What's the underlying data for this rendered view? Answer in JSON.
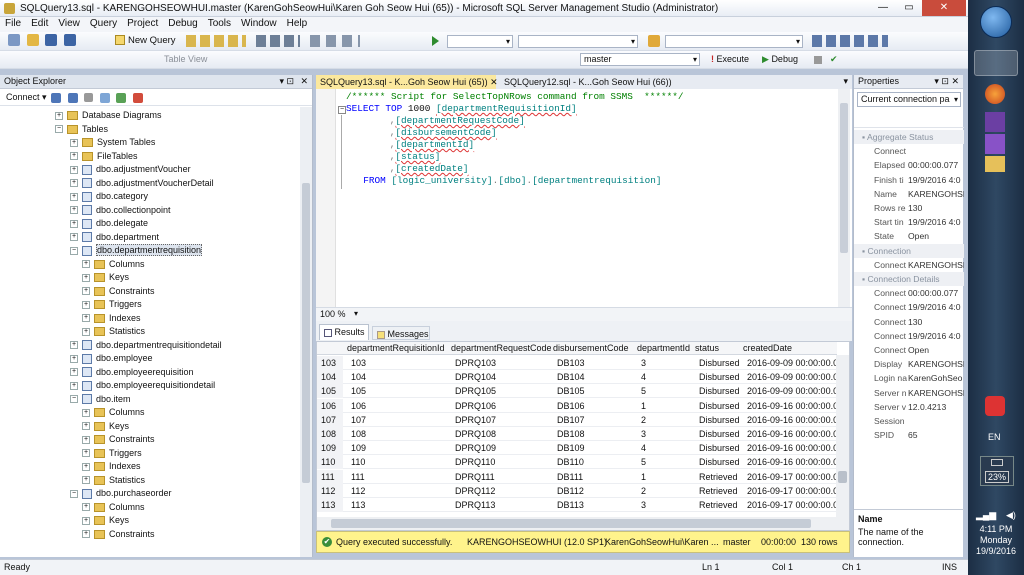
{
  "window": {
    "title": "SQLQuery13.sql - KARENGOHSEOWHUI.master (KarenGohSeowHui\\Karen Goh Seow Hui (65)) - Microsoft SQL Server Management Studio (Administrator)",
    "min": "—",
    "max": "▭",
    "close": "✕"
  },
  "menu": [
    "File",
    "Edit",
    "View",
    "Query",
    "Project",
    "Debug",
    "Tools",
    "Window",
    "Help"
  ],
  "toolbar": {
    "new_query": "New Query",
    "database": "master",
    "execute": "Execute",
    "debug": "Debug",
    "table_view": "Table View"
  },
  "object_explorer": {
    "title": "Object Explorer",
    "connect": "Connect",
    "nodes": [
      {
        "label": "Database Diagrams",
        "level": 1,
        "icon": "folder",
        "exp": "+"
      },
      {
        "label": "Tables",
        "level": 1,
        "icon": "folder",
        "exp": "−"
      },
      {
        "label": "System Tables",
        "level": 2,
        "icon": "folder",
        "exp": "+"
      },
      {
        "label": "FileTables",
        "level": 2,
        "icon": "folder",
        "exp": "+"
      },
      {
        "label": "dbo.adjustmentVoucher",
        "level": 2,
        "icon": "table",
        "exp": "+"
      },
      {
        "label": "dbo.adjustmentVoucherDetail",
        "level": 2,
        "icon": "table",
        "exp": "+"
      },
      {
        "label": "dbo.category",
        "level": 2,
        "icon": "table",
        "exp": "+"
      },
      {
        "label": "dbo.collectionpoint",
        "level": 2,
        "icon": "table",
        "exp": "+"
      },
      {
        "label": "dbo.delegate",
        "level": 2,
        "icon": "table",
        "exp": "+"
      },
      {
        "label": "dbo.department",
        "level": 2,
        "icon": "table",
        "exp": "+"
      },
      {
        "label": "dbo.departmentrequisition",
        "level": 2,
        "icon": "table",
        "exp": "−",
        "selected": true
      },
      {
        "label": "Columns",
        "level": 3,
        "icon": "folder",
        "exp": "+"
      },
      {
        "label": "Keys",
        "level": 3,
        "icon": "folder",
        "exp": "+"
      },
      {
        "label": "Constraints",
        "level": 3,
        "icon": "folder",
        "exp": "+"
      },
      {
        "label": "Triggers",
        "level": 3,
        "icon": "folder",
        "exp": "+"
      },
      {
        "label": "Indexes",
        "level": 3,
        "icon": "folder",
        "exp": "+"
      },
      {
        "label": "Statistics",
        "level": 3,
        "icon": "folder",
        "exp": "+"
      },
      {
        "label": "dbo.departmentrequisitiondetail",
        "level": 2,
        "icon": "table",
        "exp": "+"
      },
      {
        "label": "dbo.employee",
        "level": 2,
        "icon": "table",
        "exp": "+"
      },
      {
        "label": "dbo.employeerequisition",
        "level": 2,
        "icon": "table",
        "exp": "+"
      },
      {
        "label": "dbo.employeerequisitiondetail",
        "level": 2,
        "icon": "table",
        "exp": "+"
      },
      {
        "label": "dbo.item",
        "level": 2,
        "icon": "table",
        "exp": "−"
      },
      {
        "label": "Columns",
        "level": 3,
        "icon": "folder",
        "exp": "+"
      },
      {
        "label": "Keys",
        "level": 3,
        "icon": "folder",
        "exp": "+"
      },
      {
        "label": "Constraints",
        "level": 3,
        "icon": "folder",
        "exp": "+"
      },
      {
        "label": "Triggers",
        "level": 3,
        "icon": "folder",
        "exp": "+"
      },
      {
        "label": "Indexes",
        "level": 3,
        "icon": "folder",
        "exp": "+"
      },
      {
        "label": "Statistics",
        "level": 3,
        "icon": "folder",
        "exp": "+"
      },
      {
        "label": "dbo.purchaseorder",
        "level": 2,
        "icon": "table",
        "exp": "−"
      },
      {
        "label": "Columns",
        "level": 3,
        "icon": "folder",
        "exp": "+"
      },
      {
        "label": "Keys",
        "level": 3,
        "icon": "folder",
        "exp": "+"
      },
      {
        "label": "Constraints",
        "level": 3,
        "icon": "folder",
        "exp": "+"
      }
    ]
  },
  "tabs": [
    {
      "label": "SQLQuery13.sql - K...Goh Seow Hui (65))",
      "active": true
    },
    {
      "label": "SQLQuery12.sql - K...Goh Seow Hui (66))",
      "active": false
    }
  ],
  "editor": {
    "lines": [
      [
        [
          "cm",
          "/****** Script for SelectTopNRows command from SSMS  ******/"
        ]
      ],
      [
        [
          "kw",
          "SELECT TOP "
        ],
        [
          "tx",
          "1000 "
        ],
        [
          "br",
          "[departmentRequisitionId]"
        ]
      ],
      [
        [
          "gr",
          "      ,"
        ],
        [
          "br",
          "[departmentRequestCode]"
        ]
      ],
      [
        [
          "gr",
          "      ,"
        ],
        [
          "br",
          "[disbursementCode]"
        ]
      ],
      [
        [
          "gr",
          "      ,"
        ],
        [
          "br",
          "[departmentId]"
        ]
      ],
      [
        [
          "gr",
          "      ,"
        ],
        [
          "br",
          "[status]"
        ]
      ],
      [
        [
          "gr",
          "      ,"
        ],
        [
          "br",
          "[createdDate]"
        ]
      ],
      [
        [
          "kw",
          "  FROM "
        ],
        [
          "br",
          "[logic_university]"
        ],
        [
          "gr",
          "."
        ],
        [
          "br",
          "[dbo]"
        ],
        [
          "gr",
          "."
        ],
        [
          "br",
          "[departmentrequisition]"
        ]
      ]
    ],
    "zoom": "100 %"
  },
  "results_tabs": {
    "results": "Results",
    "messages": "Messages"
  },
  "grid": {
    "columns": [
      "departmentRequisitionId",
      "departmentRequestCode",
      "disbursementCode",
      "departmentId",
      "status",
      "createdDate"
    ],
    "rows": [
      [
        "103",
        "103",
        "DPRQ103",
        "DB103",
        "3",
        "Disbursed",
        "2016-09-09 00:00:00.000"
      ],
      [
        "104",
        "104",
        "DPRQ104",
        "DB104",
        "4",
        "Disbursed",
        "2016-09-09 00:00:00.000"
      ],
      [
        "105",
        "105",
        "DPRQ105",
        "DB105",
        "5",
        "Disbursed",
        "2016-09-09 00:00:00.000"
      ],
      [
        "106",
        "106",
        "DPRQ106",
        "DB106",
        "1",
        "Disbursed",
        "2016-09-16 00:00:00.000"
      ],
      [
        "107",
        "107",
        "DPRQ107",
        "DB107",
        "2",
        "Disbursed",
        "2016-09-16 00:00:00.000"
      ],
      [
        "108",
        "108",
        "DPRQ108",
        "DB108",
        "3",
        "Disbursed",
        "2016-09-16 00:00:00.000"
      ],
      [
        "109",
        "109",
        "DPRQ109",
        "DB109",
        "4",
        "Disbursed",
        "2016-09-16 00:00:00.000"
      ],
      [
        "110",
        "110",
        "DPRQ110",
        "DB110",
        "5",
        "Disbursed",
        "2016-09-16 00:00:00.000"
      ],
      [
        "111",
        "111",
        "DPRQ111",
        "DB111",
        "1",
        "Retrieved",
        "2016-09-17 00:00:00.000"
      ],
      [
        "112",
        "112",
        "DPRQ112",
        "DB112",
        "2",
        "Retrieved",
        "2016-09-17 00:00:00.000"
      ],
      [
        "113",
        "113",
        "DPRQ113",
        "DB113",
        "3",
        "Retrieved",
        "2016-09-17 00:00:00.000"
      ]
    ]
  },
  "query_status": {
    "message": "Query executed successfully.",
    "server": "KARENGOHSEOWHUI (12.0 SP1)",
    "user": "KarenGohSeowHui\\Karen ...",
    "db": "master",
    "time": "00:00:00",
    "rows": "130 rows"
  },
  "properties": {
    "title": "Properties",
    "selector": "Current connection pa",
    "section1": "Aggregate Status",
    "items1": [
      [
        "Connect",
        ""
      ],
      [
        "Elapsed",
        "00:00:00.077"
      ],
      [
        "Finish ti",
        "19/9/2016 4:0"
      ],
      [
        "Name",
        "KARENGOHSE"
      ],
      [
        "Rows re",
        "130"
      ],
      [
        "Start tin",
        "19/9/2016 4:0"
      ],
      [
        "State",
        "Open"
      ]
    ],
    "section2": "Connection",
    "items2": [
      [
        "Connect",
        "KARENGOHSE"
      ]
    ],
    "section3": "Connection Details",
    "items3": [
      [
        "Connect",
        "00:00:00.077"
      ],
      [
        "Connect",
        "19/9/2016 4:0"
      ],
      [
        "Connect",
        "130"
      ],
      [
        "Connect",
        "19/9/2016 4:0"
      ],
      [
        "Connect",
        "Open"
      ],
      [
        "Display",
        "KARENGOHSE"
      ],
      [
        "Login na",
        "KarenGohSeo"
      ],
      [
        "Server n",
        "KARENGOHSE"
      ],
      [
        "Server v",
        "12.0.4213"
      ],
      [
        "Session",
        ""
      ],
      [
        "SPID",
        "65"
      ]
    ],
    "desc_title": "Name",
    "desc": "The name of the connection."
  },
  "statusbar": {
    "ready": "Ready",
    "ln": "Ln 1",
    "col": "Col 1",
    "ch": "Ch 1",
    "ins": "INS"
  },
  "taskbar": {
    "lang": "EN",
    "battery": "23%",
    "time": "4:11 PM",
    "day": "Monday",
    "date": "19/9/2016"
  }
}
